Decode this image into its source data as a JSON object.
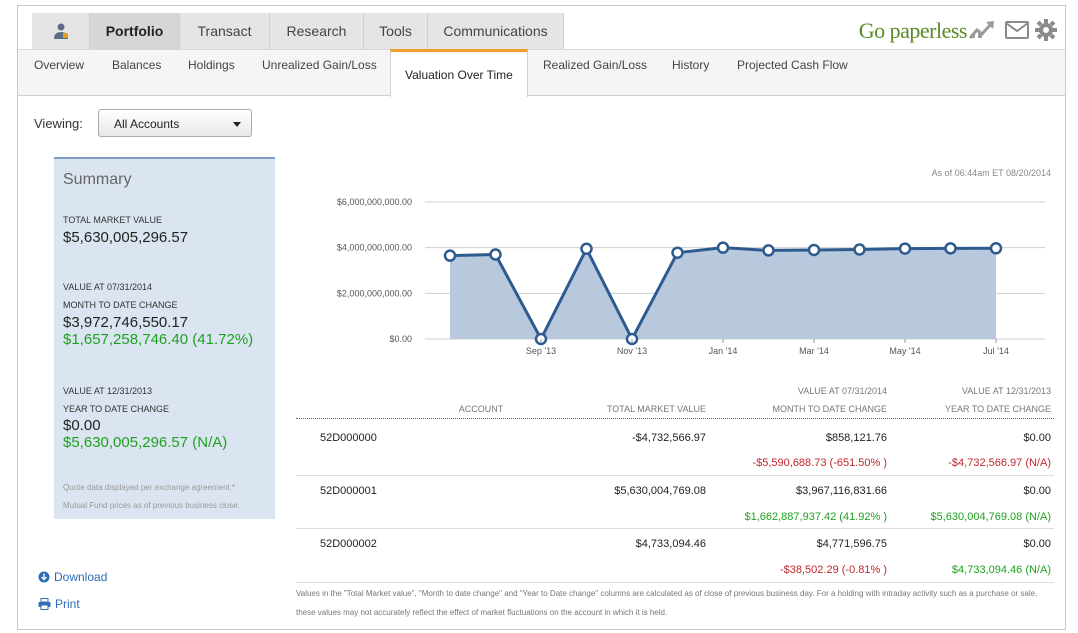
{
  "nav": {
    "tabs": [
      {
        "label": "Portfolio"
      },
      {
        "label": "Transact"
      },
      {
        "label": "Research"
      },
      {
        "label": "Tools"
      },
      {
        "label": "Communications"
      }
    ],
    "paperless": "Go paperless"
  },
  "subnav": {
    "items": [
      {
        "label": "Overview"
      },
      {
        "label": "Balances"
      },
      {
        "label": "Holdings"
      },
      {
        "label": "Unrealized Gain/Loss"
      },
      {
        "label": "Valuation Over Time"
      },
      {
        "label": "Realized Gain/Loss"
      },
      {
        "label": "History"
      },
      {
        "label": "Projected Cash Flow"
      }
    ]
  },
  "viewing": {
    "label": "Viewing:",
    "selected": "All Accounts"
  },
  "summary": {
    "title": "Summary",
    "tmv_label": "TOTAL MARKET VALUE",
    "tmv_value": "$5,630,005,296.57",
    "mtd_label1": "VALUE AT 07/31/2014",
    "mtd_label2": "MONTH TO DATE CHANGE",
    "mtd_value": "$3,972,746,550.17",
    "mtd_change": "$1,657,258,746.40 (41.72%)",
    "ytd_label1": "VALUE AT 12/31/2013",
    "ytd_label2": "YEAR TO DATE CHANGE",
    "ytd_value": "$0.00",
    "ytd_change": "$5,630,005,296.57 (N/A)",
    "note1": "Quote data displayed per exchange agreement.*",
    "note2": "Mutual Fund prices as of previous business close."
  },
  "links": {
    "download": "Download",
    "print": "Print"
  },
  "asof": "As of 06:44am ET 08/20/2014",
  "chart_data": {
    "type": "area",
    "y_ticks": [
      "$6,000,000,000.00",
      "$4,000,000,000.00",
      "$2,000,000,000.00",
      "$0.00"
    ],
    "ylim": [
      0,
      6000000000
    ],
    "x_ticks": [
      "Sep '13",
      "Nov '13",
      "Jan '14",
      "Mar '14",
      "May '14",
      "Jul '14"
    ],
    "x": [
      "Jul '13",
      "Aug '13",
      "Sep '13",
      "Oct '13",
      "Nov '13",
      "Dec '13",
      "Jan '14",
      "Feb '14",
      "Mar '14",
      "Apr '14",
      "May '14",
      "Jun '14",
      "Jul '14"
    ],
    "values": [
      3650000000,
      3700000000,
      0,
      3950000000,
      0,
      3780000000,
      4000000000,
      3880000000,
      3900000000,
      3920000000,
      3960000000,
      3970000000,
      3972746550
    ],
    "colors": {
      "line": "#2e5b8e",
      "fill": "#b8c9dd",
      "point_fill": "#ffffff"
    }
  },
  "table": {
    "headers": {
      "account": "ACCOUNT",
      "tmv": "TOTAL MARKET VALUE",
      "mtd1": "VALUE AT 07/31/2014",
      "mtd2": "MONTH TO DATE CHANGE",
      "ytd1": "VALUE AT 12/31/2013",
      "ytd2": "YEAR TO DATE CHANGE"
    },
    "rows": [
      {
        "account": "52D000000",
        "tmv": "-$4,732,566.97",
        "mtd": "$858,121.76",
        "ytd": "$0.00",
        "mtd_change": "-$5,590,688.73 (-651.50% )",
        "ytd_change": "-$4,732,566.97 (N/A)",
        "mtd_color": "red",
        "ytd_color": "red"
      },
      {
        "account": "52D000001",
        "tmv": "$5,630,004,769.08",
        "mtd": "$3,967,116,831.66",
        "ytd": "$0.00",
        "mtd_change": "$1,662,887,937.42 (41.92% )",
        "ytd_change": "$5,630,004,769.08 (N/A)",
        "mtd_color": "green",
        "ytd_color": "green"
      },
      {
        "account": "52D000002",
        "tmv": "$4,733,094.46",
        "mtd": "$4,771,596.75",
        "ytd": "$0.00",
        "mtd_change": "-$38,502.29 (-0.81% )",
        "ytd_change": "$4,733,094.46 (N/A)",
        "mtd_color": "red",
        "ytd_color": "green"
      }
    ]
  },
  "footnote": "Values in the \"Total Market value\", \"Month to date change\" and \"Year to Date change\" columns are calculated as of close of previous business day. For a holding with intraday activity such as a purchase or sale, these values may not accurately reflect the effect of market fluctuations on the account in which it is held."
}
